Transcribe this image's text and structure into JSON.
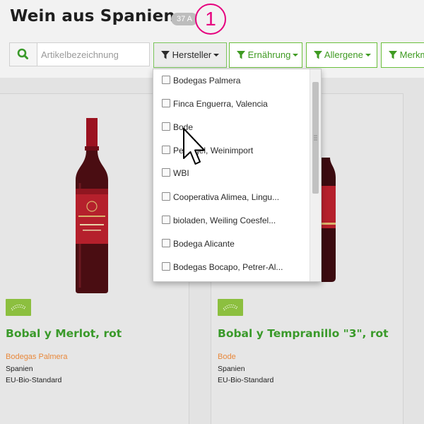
{
  "page": {
    "title": "Wein aus Spanien",
    "count_badge": "37 A",
    "step_number": "1"
  },
  "search": {
    "placeholder": "Artikelbezeichnung",
    "icon": "search-icon"
  },
  "filters": [
    {
      "label": "Hersteller",
      "icon": "funnel-icon",
      "active": true
    },
    {
      "label": "Ernährung",
      "icon": "funnel-icon",
      "active": false
    },
    {
      "label": "Allergene",
      "icon": "funnel-icon",
      "active": false
    },
    {
      "label": "Merkm",
      "icon": "funnel-icon",
      "active": false
    }
  ],
  "dropdown": {
    "items": [
      {
        "label": "Bodegas Palmera",
        "checked": false
      },
      {
        "label": "Finca Enguerra, Valencia",
        "checked": false
      },
      {
        "label": "Bode",
        "checked": false
      },
      {
        "label": "Pet…gel, Weinimport",
        "checked": false
      },
      {
        "label": "WBI",
        "checked": false
      },
      {
        "label": "Cooperativa Alimea, Lingu...",
        "checked": false
      },
      {
        "label": "bioladen, Weiling Coesfel...",
        "checked": false
      },
      {
        "label": "Bodega Alicante",
        "checked": false
      },
      {
        "label": "Bodegas Bocapo, Petrer-Al...",
        "checked": false
      }
    ]
  },
  "products": [
    {
      "name": "Bobal y Merlot, rot",
      "producer": "Bodegas Palmera",
      "country": "Spanien",
      "certification": "EU-Bio-Standard"
    },
    {
      "name": "Bobal y Tempranillo \"3\", rot",
      "producer": "Bode",
      "country": "Spanien",
      "certification": "EU-Bio-Standard"
    }
  ],
  "colors": {
    "accent_green": "#3a9a2a",
    "producer_orange": "#e8883b",
    "step_pink": "#e6007e",
    "bio_badge": "#8cbf3f"
  }
}
